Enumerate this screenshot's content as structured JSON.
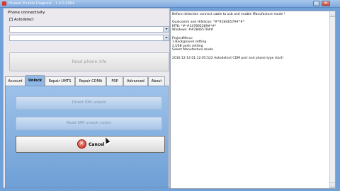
{
  "window": {
    "title": "Huawei Enable Diagnost - 1.0.0.0064"
  },
  "connectivity": {
    "title": "Phone connectivity",
    "autodetect_label": "Autodetect",
    "autodetect_checked": true,
    "port_combo_value": "",
    "port_combo2_value": "",
    "read_button": "Read phone info"
  },
  "tabs": [
    "Account",
    "Unlock",
    "Repair UMTS",
    "Repair CDMA",
    "FRP",
    "Advanced",
    "About"
  ],
  "active_tab": "Unlock",
  "unlock": {
    "button1": "Direct SIM unlock",
    "button2": "Read SIM unlock codes",
    "cancel_button": "Cancel"
  },
  "log": {
    "lines": [
      "Before detection connect cable to usb and enable Manufacture mode !",
      "",
      "Qualcomm and HiSilicon: *#*#2846579#*#*",
      "MTK: *#*#147895369#*#*",
      "Windows: ##2846579##",
      "",
      "ProjectMenu:",
      "1.Background setting",
      "2.USB ports setting",
      "Select Manufacture mode",
      "",
      "2016:12:14 01:12:05:522 Autodetect CDM port and phone type start!"
    ]
  }
}
